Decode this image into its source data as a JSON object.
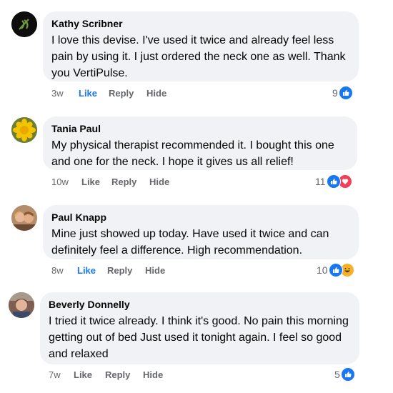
{
  "comments": [
    {
      "author": "Kathy Scribner",
      "text": "I love this devise. I've used it twice and already feel less pain by using it. I just ordered the neck one as well. Thank you VertiPulse.",
      "time": "3w",
      "like_label": "Like",
      "liked": true,
      "reply_label": "Reply",
      "hide_label": "Hide",
      "reaction_count": "9",
      "reactions": [
        "like"
      ]
    },
    {
      "author": "Tania Paul",
      "text": "My physical therapist recommended it. I bought this one and one for the neck. I hope it gives us all relief!",
      "time": "10w",
      "like_label": "Like",
      "liked": false,
      "reply_label": "Reply",
      "hide_label": "Hide",
      "reaction_count": "11",
      "reactions": [
        "like",
        "love"
      ]
    },
    {
      "author": "Paul Knapp",
      "text": "Mine just showed up today. Have used it twice and can definitely feel a difference. High recommendation.",
      "time": "8w",
      "like_label": "Like",
      "liked": true,
      "reply_label": "Reply",
      "hide_label": "Hide",
      "reaction_count": "10",
      "reactions": [
        "like",
        "haha"
      ]
    },
    {
      "author": "Beverly Donnelly",
      "text": "I tried it twice already. I think it's good. No pain this morning getting out of bed Just used it tonight again. I feel so good and relaxed",
      "time": "7w",
      "like_label": "Like",
      "liked": false,
      "reply_label": "Reply",
      "hide_label": "Hide",
      "reaction_count": "5",
      "reactions": [
        "like"
      ]
    }
  ],
  "colors": {
    "bubble": "#f0f2f5",
    "like_blue": "#1877f2",
    "love_red": "#f33e58",
    "haha_yellow": "#f7b125",
    "meta_gray": "#65676b"
  }
}
